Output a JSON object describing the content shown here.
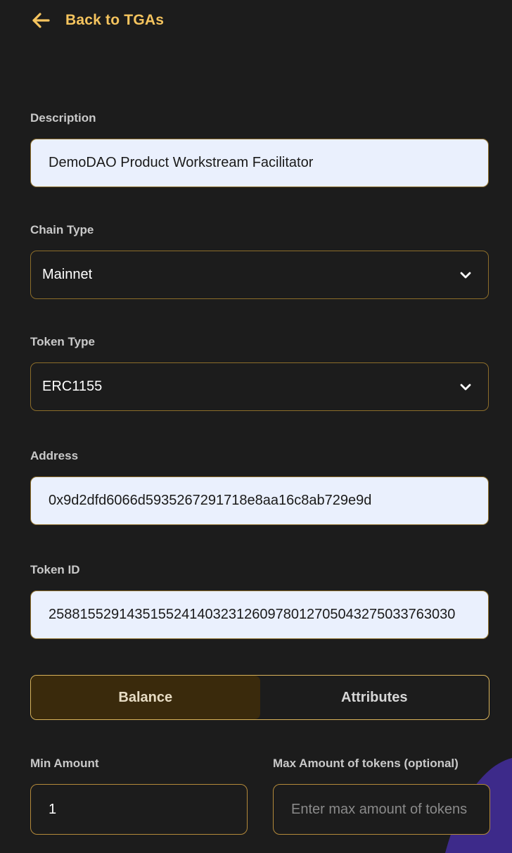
{
  "header": {
    "back_label": "Back to TGAs"
  },
  "form": {
    "description": {
      "label": "Description",
      "value": "DemoDAO Product Workstream Facilitator"
    },
    "chain_type": {
      "label": "Chain Type",
      "selected": "Mainnet"
    },
    "token_type": {
      "label": "Token Type",
      "selected": "ERC1155"
    },
    "address": {
      "label": "Address",
      "value": "0x9d2dfd6066d5935267291718e8aa16c8ab729e9d"
    },
    "token_id": {
      "label": "Token ID",
      "value": "2588155291435155241403231260978012705043275033763030"
    },
    "tabs": [
      {
        "label": "Balance",
        "active": true
      },
      {
        "label": "Attributes",
        "active": false
      }
    ],
    "min_amount": {
      "label": "Min Amount",
      "value": "1"
    },
    "max_amount": {
      "label": "Max Amount of tokens (optional)",
      "placeholder": "Enter max amount of tokens"
    }
  },
  "colors": {
    "background": "#1c1c1c",
    "accent": "#f5c45e",
    "field_light_bg": "#eaf0fd",
    "field_border": "#8c6d2a",
    "active_tab_bg": "#3a2a0c",
    "decor_purple": "#3d2a8a"
  },
  "icons": {
    "back": "arrow-left-icon",
    "select": "chevron-down-icon"
  }
}
